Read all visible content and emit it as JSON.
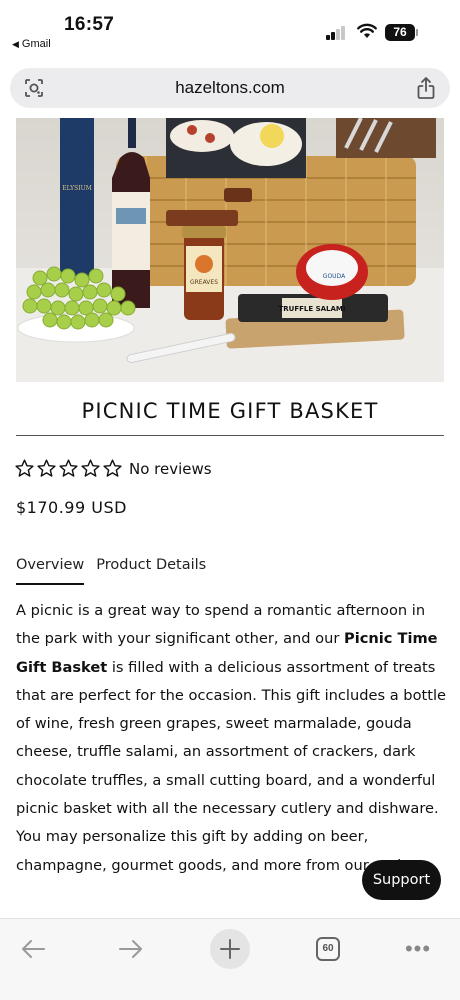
{
  "status_bar": {
    "time": "16:57",
    "back_app": "Gmail",
    "battery": "76"
  },
  "browser": {
    "url": "hazeltons.com",
    "tab_count": "60"
  },
  "product": {
    "title": "PICNIC TIME GIFT BASKET",
    "rating_stars": 0,
    "reviews_label": "No reviews",
    "price": "$170.99 USD"
  },
  "tabs": [
    {
      "label": "Overview",
      "active": true
    },
    {
      "label": "Product Details",
      "active": false
    }
  ],
  "description": {
    "part1": "A picnic is a great way to spend a romantic afternoon in the park with your significant other, and our ",
    "bold": "Picnic Time Gift Basket",
    "part2": " is filled with a delicious assortment of treats that are perfect for the occasion. This gift includes a bottle of wine, fresh green grapes, sweet marmalade, gouda cheese, truffle salami, an assortment of crackers, dark chocolate truffles, a small cutting board, and a wonderful picnic basket with all the necessary cutlery and dishware. You may personalize this gift by adding on beer, champagne, gourmet goods, and more from our options."
  },
  "image_labels": {
    "salami": "TRUFFLE SALAMI",
    "cheese": "GOUDA",
    "jam": "GREAVES",
    "box": "ELYSIUM"
  },
  "support_label": "Support",
  "icons": {
    "back": "arrow-left-icon",
    "forward": "arrow-right-icon",
    "new_tab": "plus-icon",
    "tabs": "tabs-icon",
    "more": "more-icon",
    "share": "share-icon",
    "lens": "lens-icon"
  }
}
